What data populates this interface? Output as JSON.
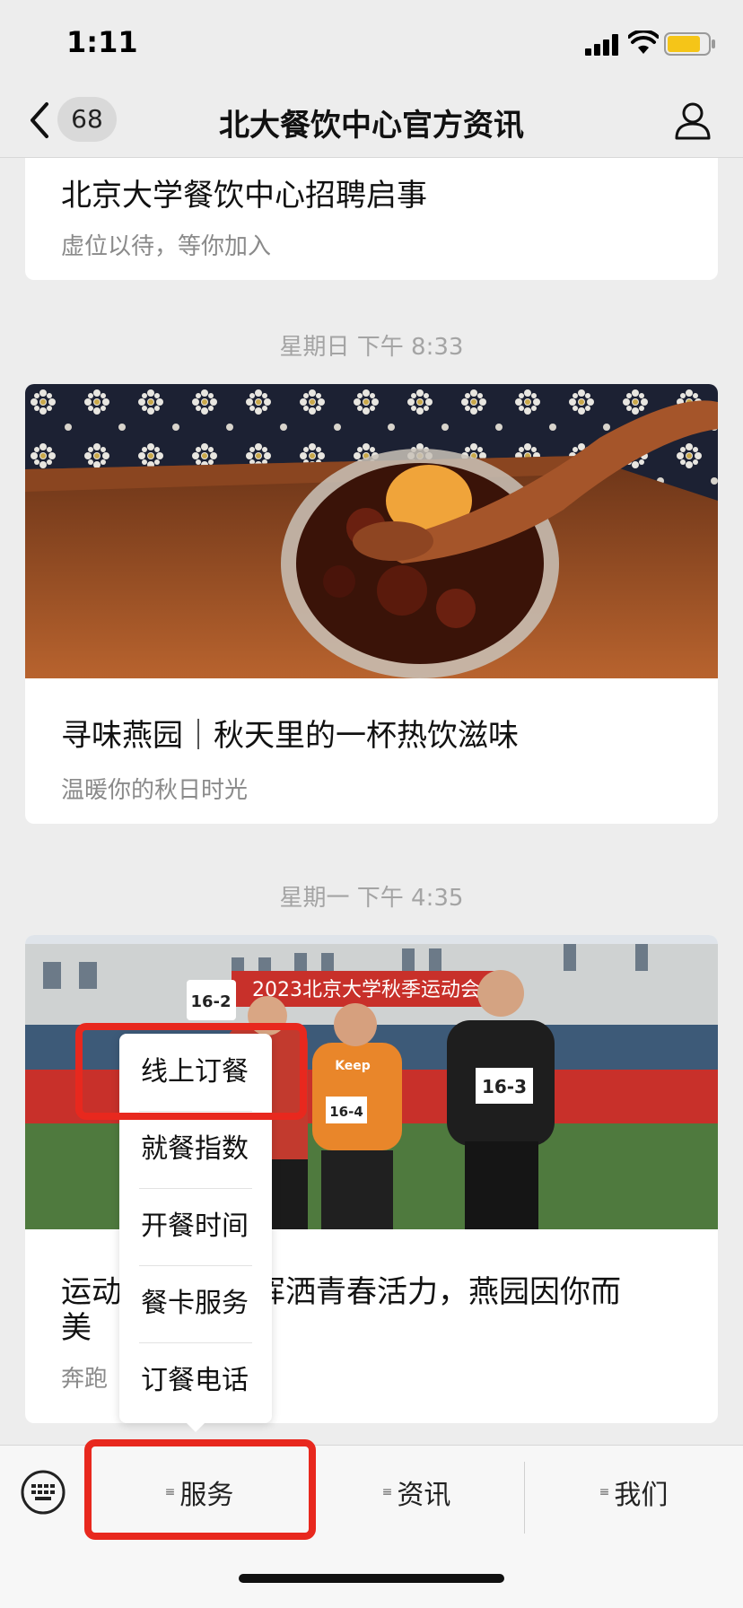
{
  "status": {
    "time": "1:11"
  },
  "nav": {
    "unread_count": "68",
    "title": "北大餐饮中心官方资讯"
  },
  "articles": [
    {
      "title": "北京大学餐饮中心招聘启事",
      "subtitle": "虚位以待，等你加入"
    },
    {
      "timestamp": "星期日 下午 8:33",
      "title": "寻味燕园｜秋天里的一杯热饮滋味",
      "subtitle": "温暖你的秋日时光"
    },
    {
      "timestamp": "星期一 下午 4:35",
      "title_line1": "运动",
      "title_line1_rest": "挥洒青春活力，燕园因你而",
      "title_line2": "美",
      "subtitle": "奔跑"
    }
  ],
  "photo3": {
    "banner": "2023北京大学秋季运动会",
    "bibs": [
      "16-2",
      "16-4",
      "16-3"
    ],
    "shirt_text": "Keep"
  },
  "popup_menu": {
    "items": [
      "线上订餐",
      "就餐指数",
      "开餐时间",
      "餐卡服务",
      "订餐电话"
    ]
  },
  "bottom_menu": {
    "tabs": [
      "服务",
      "资讯",
      "我们"
    ]
  },
  "colors": {
    "highlight": "#e8281e",
    "background": "#ededed"
  }
}
